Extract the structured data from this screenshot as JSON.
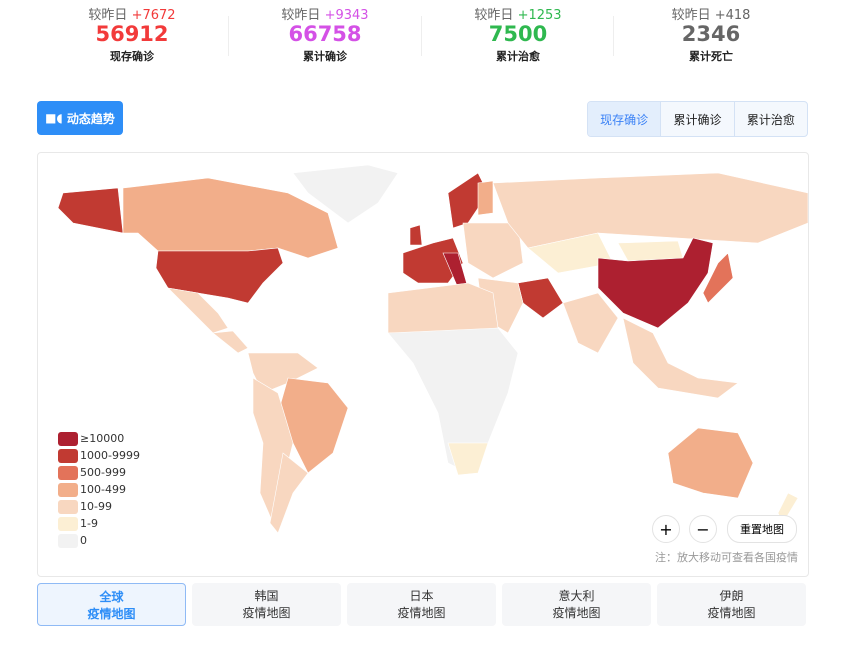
{
  "stats": [
    {
      "delta_label": "较昨日",
      "delta": "+7672",
      "value": "56912",
      "label": "现存确诊",
      "color": "#f23a3a"
    },
    {
      "delta_label": "较昨日",
      "delta": "+9343",
      "value": "66758",
      "label": "累计确诊",
      "color": "#d451e6"
    },
    {
      "delta_label": "较昨日",
      "delta": "+1253",
      "value": "7500",
      "label": "累计治愈",
      "color": "#2fb84f"
    },
    {
      "delta_label": "较昨日",
      "delta": "+418",
      "value": "2346",
      "label": "累计死亡",
      "color": "#666666"
    }
  ],
  "trend_button": "动态趋势",
  "map_tabs": [
    "现存确诊",
    "累计确诊",
    "累计治愈"
  ],
  "legend": [
    {
      "label": "≥10000",
      "color": "#ad2030"
    },
    {
      "label": "1000-9999",
      "color": "#c13a32"
    },
    {
      "label": "500-999",
      "color": "#e3735a"
    },
    {
      "label": "100-499",
      "color": "#f2ae8a"
    },
    {
      "label": "10-99",
      "color": "#f8d7c0"
    },
    {
      "label": "1-9",
      "color": "#fcefd4"
    },
    {
      "label": "0",
      "color": "#f2f2f2"
    }
  ],
  "zoom_in": "+",
  "zoom_out": "−",
  "reset": "重置地图",
  "note": "注：放大移动可查看各国疫情",
  "regions": [
    {
      "line1": "全球",
      "line2": "疫情地图"
    },
    {
      "line1": "韩国",
      "line2": "疫情地图"
    },
    {
      "line1": "日本",
      "line2": "疫情地图"
    },
    {
      "line1": "意大利",
      "line2": "疫情地图"
    },
    {
      "line1": "伊朗",
      "line2": "疫情地图"
    }
  ]
}
